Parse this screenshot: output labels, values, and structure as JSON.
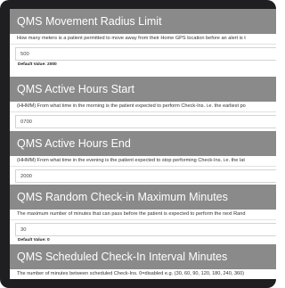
{
  "sections": [
    {
      "title": "QMS Movement Radius Limit",
      "description": "How many meters is a patient permitted to move away from their Home GPS location before an alert is t",
      "value": "500",
      "default_label": "Default Value: 2000"
    },
    {
      "title": "QMS Active Hours Start",
      "description": "(HHMM) From what time in the morning is the patient expected to perform Check-Ins. i.e. the earliest po",
      "value": "0700"
    },
    {
      "title": "QMS Active Hours End",
      "description": "(HHMM) From what time in the evening is the patient expected to stop performing Check-Ins. i.e. the lat",
      "value": "2000"
    },
    {
      "title": "QMS Random Check-in Maximum Minutes",
      "description": "The maximum number of minutes that can pass before the patient is expected to perform the next Rand",
      "value": "30",
      "default_label": "Default Value: 0"
    },
    {
      "title": "QMS Scheduled Check-In Interval Minutes",
      "description": "The number of minutes between scheduled Check-Ins. 0=disabled e.g. (30, 60, 90, 120, 180, 240, 360)"
    }
  ]
}
